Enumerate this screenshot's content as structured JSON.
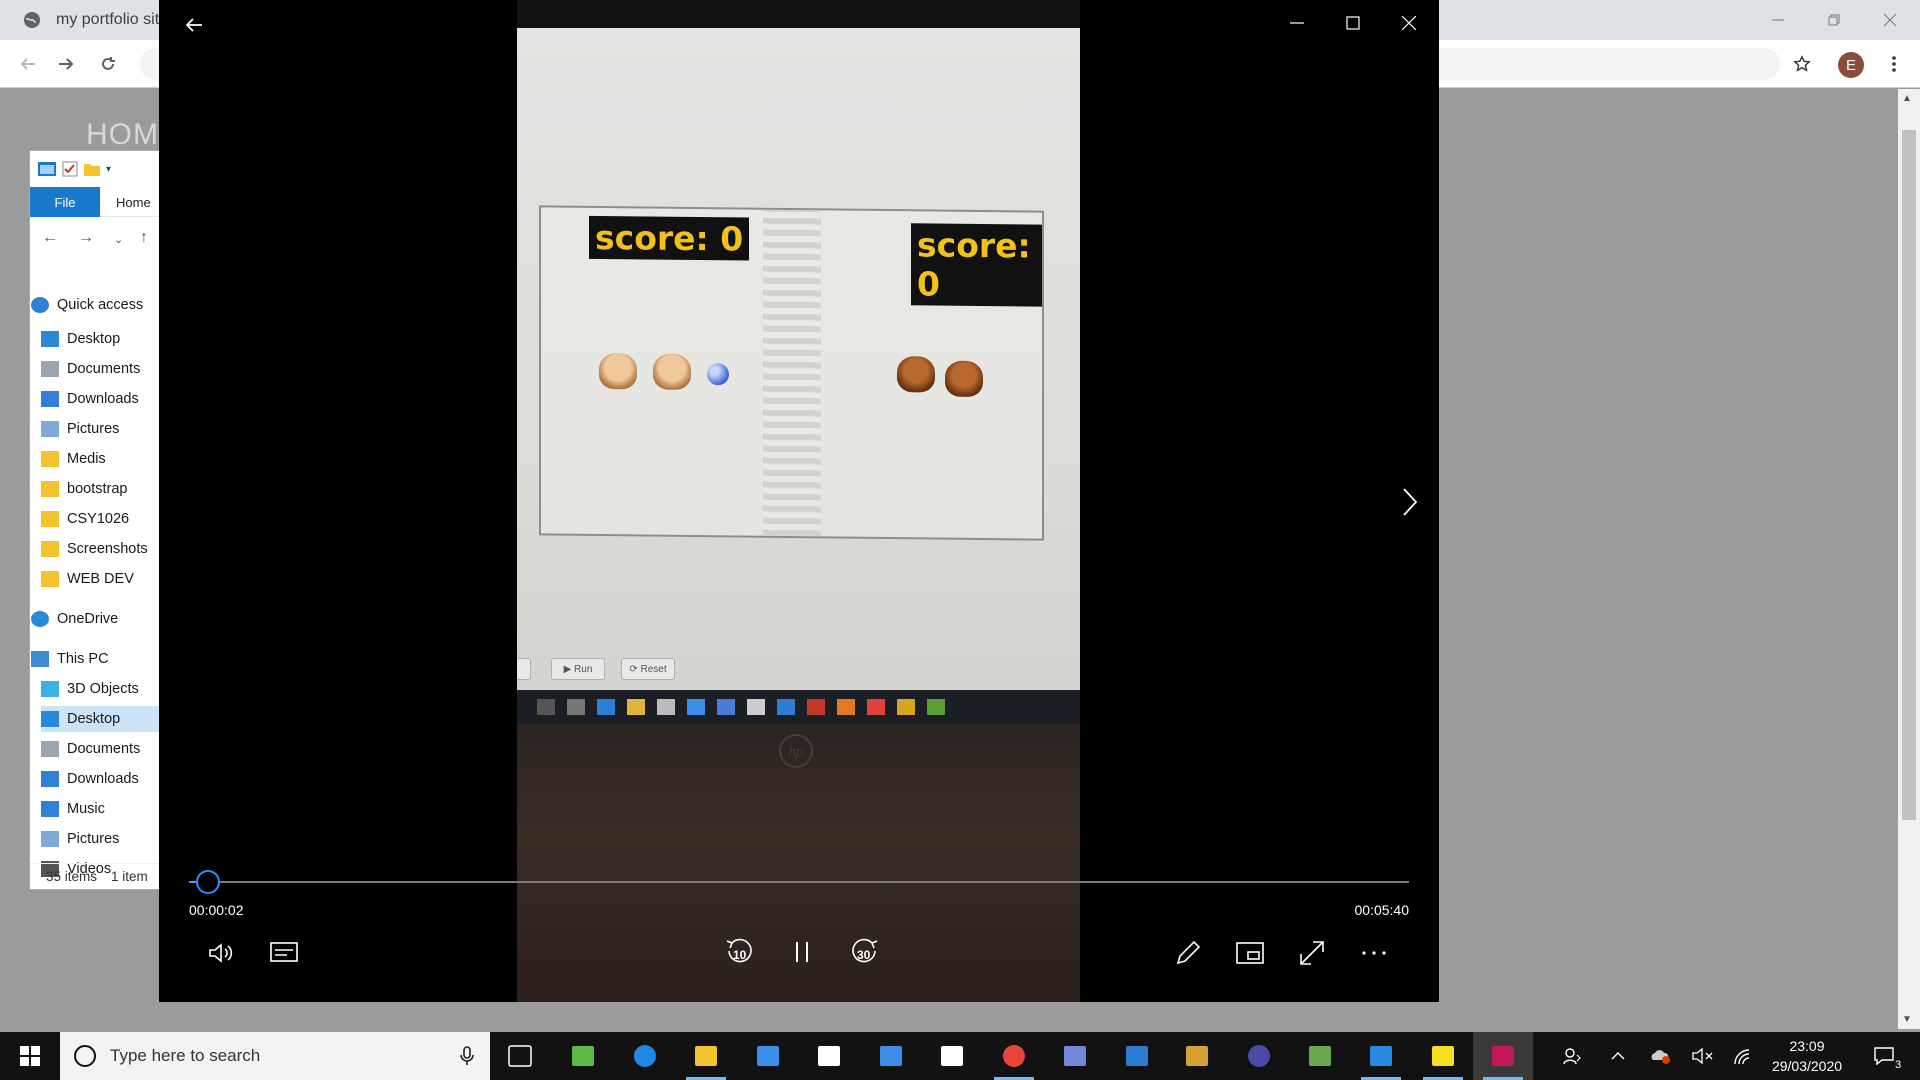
{
  "browser": {
    "tab_title": "my portfolio site",
    "profile_initial": "E"
  },
  "page": {
    "heading": "HOM"
  },
  "explorer": {
    "file_tab": "File",
    "home_tab": "Home",
    "tree": [
      {
        "label": "Quick access",
        "icon": "star-icon"
      },
      {
        "label": "Desktop",
        "icon": "desktop-icon"
      },
      {
        "label": "Documents",
        "icon": "documents-icon"
      },
      {
        "label": "Downloads",
        "icon": "downloads-icon"
      },
      {
        "label": "Pictures",
        "icon": "pictures-icon"
      },
      {
        "label": "Medis",
        "icon": "folder-icon"
      },
      {
        "label": "bootstrap",
        "icon": "folder-icon"
      },
      {
        "label": "CSY1026",
        "icon": "folder-icon"
      },
      {
        "label": "Screenshots",
        "icon": "folder-icon"
      },
      {
        "label": "WEB DEV",
        "icon": "folder-icon"
      },
      {
        "label": "OneDrive",
        "icon": "cloud-icon"
      },
      {
        "label": "This PC",
        "icon": "pc-icon"
      },
      {
        "label": "3D Objects",
        "icon": "cube-icon"
      },
      {
        "label": "Desktop",
        "icon": "desktop-icon"
      },
      {
        "label": "Documents",
        "icon": "documents-icon"
      },
      {
        "label": "Downloads",
        "icon": "downloads-icon"
      },
      {
        "label": "Music",
        "icon": "music-icon"
      },
      {
        "label": "Pictures",
        "icon": "pictures-icon"
      },
      {
        "label": "Videos",
        "icon": "videos-icon"
      }
    ],
    "status_items": "35 items",
    "status_selected": "1 item"
  },
  "player": {
    "video": {
      "score_left": "score: 0",
      "score_right": "score: 0",
      "btn_run": "Run",
      "btn_reset": "Reset",
      "laptop_brand": "hp"
    },
    "time_current": "00:00:02",
    "time_total": "00:05:40",
    "progress_fraction": 0.006,
    "rewind_seconds": "10",
    "forward_seconds": "30"
  },
  "taskbar": {
    "search_placeholder": "Type here to search",
    "time": "23:09",
    "date": "29/03/2020",
    "notification_count": "3",
    "apps": [
      "task-view-icon",
      "footprint-app-icon",
      "edge-icon",
      "file-explorer-icon",
      "visual-studio-icon",
      "store-icon",
      "mail-icon",
      "dropbox-icon",
      "chrome-icon",
      "discord-icon",
      "app-window-icon",
      "git-kraken-icon",
      "eclipse-icon",
      "gimp-icon",
      "vscode-icon",
      "sticky-notes-icon",
      "movies-tv-icon"
    ]
  },
  "colors": {
    "accent_blue": "#1979ca",
    "progress_blue": "#4aa3ff",
    "score_yellow": "#f2c21b"
  }
}
